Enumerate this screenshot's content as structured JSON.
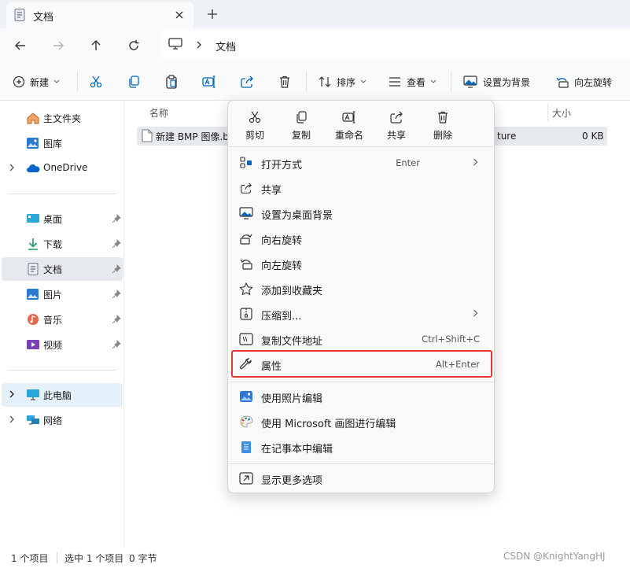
{
  "window": {
    "tab_title": "文档",
    "tab_icon": "document-icon",
    "new_tab_icon": "plus-icon"
  },
  "nav": {
    "breadcrumb": "文档",
    "icons": [
      "back-arrow-icon",
      "forward-arrow-icon",
      "up-arrow-icon",
      "refresh-icon",
      "computer-icon"
    ]
  },
  "toolbar": {
    "new_label": "新建",
    "sort_label": "排序",
    "view_label": "查看",
    "set_bg_label": "设置为背景",
    "rotate_left_label": "向左旋转"
  },
  "sidebar": {
    "quick": [
      {
        "label": "主文件夹",
        "icon": "home-icon"
      },
      {
        "label": "图库",
        "icon": "gallery-icon"
      },
      {
        "label": "OneDrive",
        "icon": "cloud-icon"
      }
    ],
    "pinned": [
      {
        "label": "桌面",
        "icon": "desktop-icon"
      },
      {
        "label": "下载",
        "icon": "download-icon"
      },
      {
        "label": "文档",
        "icon": "document-icon"
      },
      {
        "label": "图片",
        "icon": "pictures-icon"
      },
      {
        "label": "音乐",
        "icon": "music-icon"
      },
      {
        "label": "视频",
        "icon": "video-icon"
      }
    ],
    "system": [
      {
        "label": "此电脑",
        "icon": "this-pc-icon"
      },
      {
        "label": "网络",
        "icon": "network-icon"
      }
    ]
  },
  "content": {
    "col_name": "名称",
    "col_size": "大小",
    "file_name": "新建 BMP 图像.b",
    "file_type_fragment": "ture",
    "file_size": "0 KB"
  },
  "context_menu": {
    "quick_actions": [
      {
        "label": "剪切",
        "icon": "cut-icon"
      },
      {
        "label": "复制",
        "icon": "copy-icon"
      },
      {
        "label": "重命名",
        "icon": "rename-icon"
      },
      {
        "label": "共享",
        "icon": "share-icon"
      },
      {
        "label": "删除",
        "icon": "delete-icon"
      }
    ],
    "items": [
      {
        "label": "打开方式",
        "shortcut": "Enter",
        "submenu": true,
        "icon": "open-with-icon"
      },
      {
        "label": "共享",
        "shortcut": "",
        "submenu": false,
        "icon": "share-icon"
      },
      {
        "label": "设置为桌面背景",
        "shortcut": "",
        "submenu": false,
        "icon": "wallpaper-icon"
      },
      {
        "label": "向右旋转",
        "shortcut": "",
        "submenu": false,
        "icon": "rotate-right-icon"
      },
      {
        "label": "向左旋转",
        "shortcut": "",
        "submenu": false,
        "icon": "rotate-left-icon"
      },
      {
        "label": "添加到收藏夹",
        "shortcut": "",
        "submenu": false,
        "icon": "star-icon"
      },
      {
        "label": "压缩到...",
        "shortcut": "",
        "submenu": true,
        "icon": "archive-icon"
      },
      {
        "label": "复制文件地址",
        "shortcut": "Ctrl+Shift+C",
        "submenu": false,
        "icon": "copy-path-icon"
      },
      {
        "label": "属性",
        "shortcut": "Alt+Enter",
        "submenu": false,
        "icon": "wrench-icon"
      },
      {
        "label": "使用照片编辑",
        "shortcut": "",
        "submenu": false,
        "icon": "photos-app-icon"
      },
      {
        "label": "使用 Microsoft 画图进行编辑",
        "shortcut": "",
        "submenu": false,
        "icon": "paint-app-icon"
      },
      {
        "label": "在记事本中编辑",
        "shortcut": "",
        "submenu": false,
        "icon": "notepad-app-icon"
      },
      {
        "label": "显示更多选项",
        "shortcut": "",
        "submenu": false,
        "icon": "more-options-icon"
      }
    ]
  },
  "status": {
    "item_count": "1 个项目",
    "selection": "选中 1 个项目",
    "size": "0 字节"
  },
  "watermark": "CSDN @KnightYangHJ",
  "colors": {
    "accent": "#0067c0",
    "highlight_box": "#e53935",
    "selection_bg": "#e6e9ee"
  }
}
